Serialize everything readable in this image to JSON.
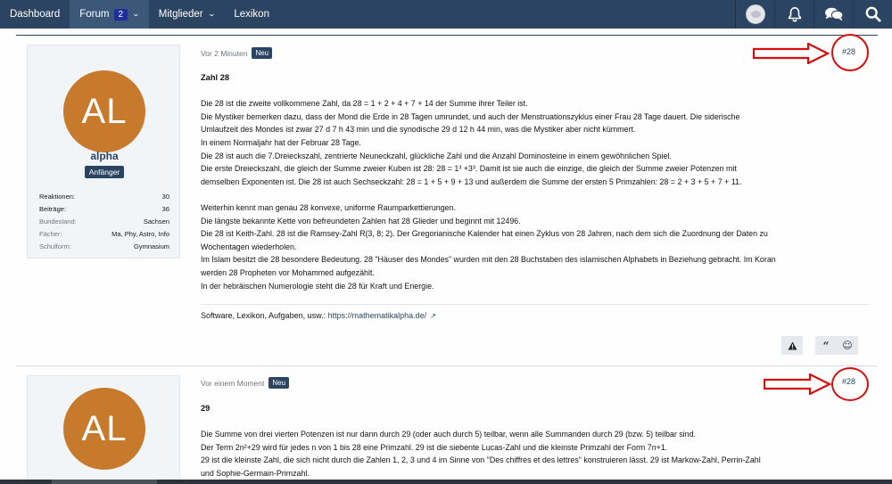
{
  "nav": {
    "items": [
      {
        "label": "Dashboard"
      },
      {
        "label": "Forum",
        "badge": "2"
      },
      {
        "label": "Mitglieder"
      },
      {
        "label": "Lexikon"
      }
    ],
    "icons": [
      "avatar",
      "bell-icon",
      "chat-bubbles-icon",
      "search-icon"
    ]
  },
  "posts": [
    {
      "time": "Vor 2 Minuten",
      "badge": "Neu",
      "number": "#28",
      "title": "Zahl 28",
      "lines": [
        "Die 28 ist die zweite vollkommene Zahl, da 28 = 1 + 2 + 4 + 7 + 14 der Summe ihrer Teiler ist.",
        "Die Mystiker bemerken dazu, dass der Mond die Erde in 28 Tagen umrundet, und auch der Menstruationszyklus einer Frau 28 Tage dauert. Die siderische",
        "Umlaufzeit des Mondes ist zwar 27 d 7 h 43 min und die synodische 29 d 12 h 44 min, was die Mystiker aber nicht kümmert.",
        "In einem Normaljahr hat der Februar 28 Tage.",
        "Die 28 ist auch die 7.Dreieckszahl, zentrierte Neuneckzahl, glückliche Zahl und die Anzahl Dominosteine in einem gewöhnlichen Spiel.",
        "Die erste Dreieckszahl, die gleich der Summe zweier Kuben ist 28: 28 = 1³ +3³. Damit ist sie auch die einzige, die gleich der Summe zweier Potenzen mit",
        "demselben Exponenten ist. Die 28 ist auch Sechseckzahl: 28 = 1 + 5 + 9 + 13 und außerdem die Summe der ersten 5 Primzahlen: 28 = 2 + 3 + 5 + 7 + 11.",
        "",
        "Weiterhin kennt man genau 28 konvexe, uniforme Raumparkettierungen.",
        "Die längste bekannte Kette von befreundeten Zahlen hat 28 Glieder und beginnt mit 12496.",
        "Die 28 ist Keith-Zahl. 28 ist die Ramsey-Zahl R(3, 8; 2). Der Gregorianische Kalender hat einen Zyklus von 28 Jahren, nach dem sich die Zuordnung der Daten zu",
        "Wochentagen wiederholen.",
        "Im Islam besitzt die 28 besondere Bedeutung. 28 \"Häuser des Mondes\" wurden mit den 28 Buchstaben des islamischen Alphabets in Beziehung gebracht. Im Koran",
        "werden 28 Propheten vor Mohammed aufgezählt.",
        "In der hebräischen Numerologie steht die 28 für Kraft und Energie."
      ],
      "signature": {
        "text": "Software, Lexikon, Aufgaben, usw.: ",
        "link": "https://mathematikalpha.de/"
      },
      "actions": [
        "warning-icon",
        "quote-icon",
        "smile-icon"
      ],
      "user": {
        "initials": "AL",
        "name": "alpha",
        "rank": "Anfänger",
        "stats": [
          {
            "label": "Reaktionen:",
            "value": "30"
          },
          {
            "label": "Beiträge:",
            "value": "36"
          },
          {
            "label": "Bundesland:",
            "value": "Sachsen"
          },
          {
            "label": "Fächer:",
            "value": "Ma, Phy, Astro, Info"
          },
          {
            "label": "Schulform:",
            "value": "Gymnasium"
          }
        ]
      }
    },
    {
      "time": "Vor einem Moment",
      "badge": "Neu",
      "number": "#28",
      "title": "29",
      "lines": [
        "Die Summe von drei vierten Potenzen ist nur dann durch 29 (oder auch durch 5) teilbar, wenn alle Summanden durch 29 (bzw. 5) teilbar sind.",
        "Der Term 2n²+29 wird für jedes n von 1 bis 28 eine Primzahl. 29 ist die siebente Lucas-Zahl und die kleinste Primzahl der Form 7n+1.",
        "29 ist die kleinste Zahl, die sich nicht durch die Zahlen 1, 2, 3 und 4 im Sinne von \"Des chiffres et des lettres\" konstruieren lässt. 29 ist Markow-Zahl, Perrin-Zahl",
        "und Sophie-Germain-Primzahl."
      ],
      "user": {
        "initials": "AL"
      }
    }
  ],
  "colors": {
    "nav_bg": "#2b4461",
    "accent": "#2b4461",
    "avatar_bg": "#c77a2c",
    "annotation_red": "#d60d0d"
  }
}
